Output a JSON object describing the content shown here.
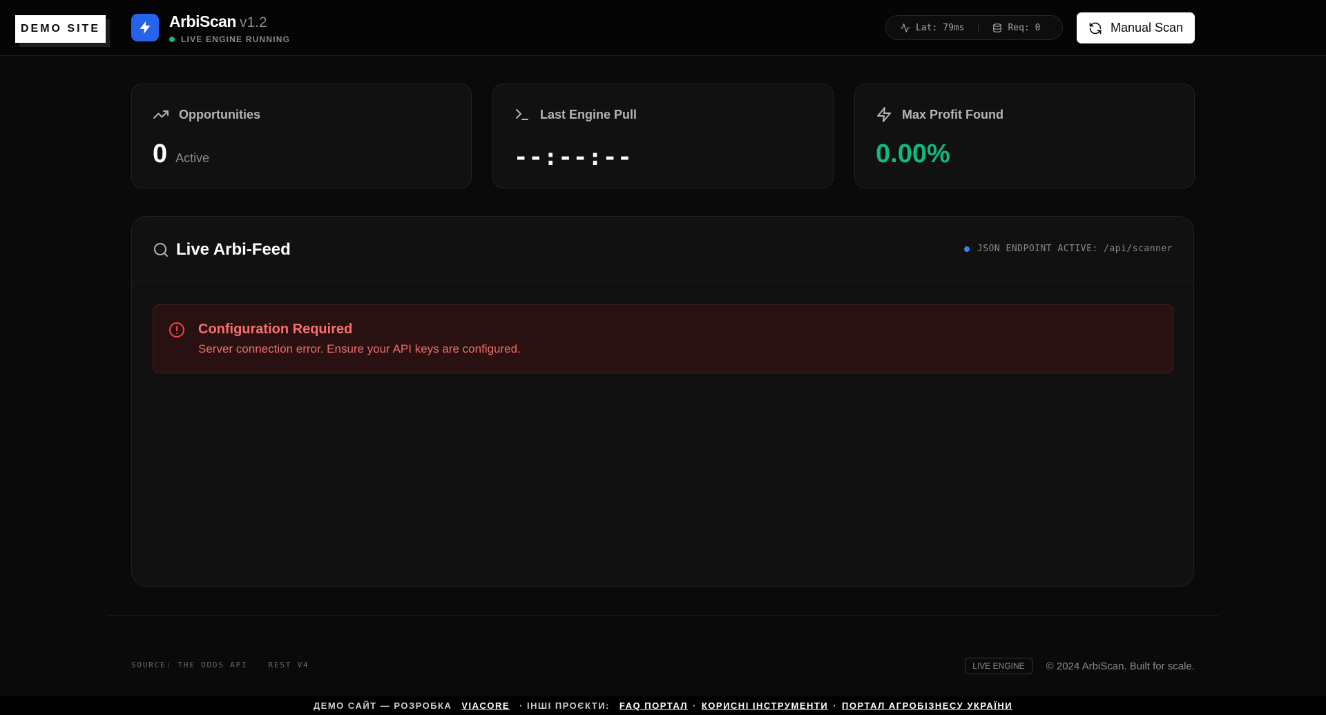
{
  "header": {
    "demo_badge": "DEMO SITE",
    "brand_title": "ArbiScan",
    "brand_version": "v1.2",
    "status_text": "LIVE ENGINE RUNNING",
    "latency": "Lat: 79ms",
    "requests": "Req: 0",
    "manual_scan_label": "Manual Scan"
  },
  "cards": {
    "opportunities": {
      "label": "Opportunities",
      "value": "0",
      "sub": "Active"
    },
    "last_pull": {
      "label": "Last Engine Pull",
      "value": "--:--:--"
    },
    "max_profit": {
      "label": "Max Profit Found",
      "value": "0.00%"
    }
  },
  "feed": {
    "title": "Live Arbi-Feed",
    "endpoint": "JSON ENDPOINT ACTIVE: /api/scanner",
    "alert_title": "Configuration Required",
    "alert_message": "Server connection error. Ensure your API keys are configured."
  },
  "footer": {
    "source": "SOURCE: THE ODDS API",
    "rest": "REST V4",
    "engine_tag": "LIVE ENGINE",
    "copyright": "© 2024 ArbiScan. Built for scale."
  },
  "bottom_bar": {
    "prefix": "ДЕМО САЙТ — РОЗРОБКА",
    "link_viacore": "VIACORE",
    "middle": "· ІНШІ ПРОЄКТИ:",
    "link_faq": "FAQ ПОРТАЛ",
    "link_tools": "КОРИСНІ ІНСТРУМЕНТИ",
    "link_agro": "ПОРТАЛ АГРОБІЗНЕСУ УКРАЇНИ",
    "dot_sep": "·"
  },
  "colors": {
    "accent_blue": "#2563eb",
    "success_green": "#10b981",
    "error_red": "#f87171",
    "background": "#0a0a0a"
  },
  "icons": [
    "bolt-icon",
    "activity-icon",
    "database-icon",
    "refresh-icon",
    "trending-up-icon",
    "terminal-icon",
    "zap-icon",
    "search-icon",
    "alert-circle-icon"
  ]
}
